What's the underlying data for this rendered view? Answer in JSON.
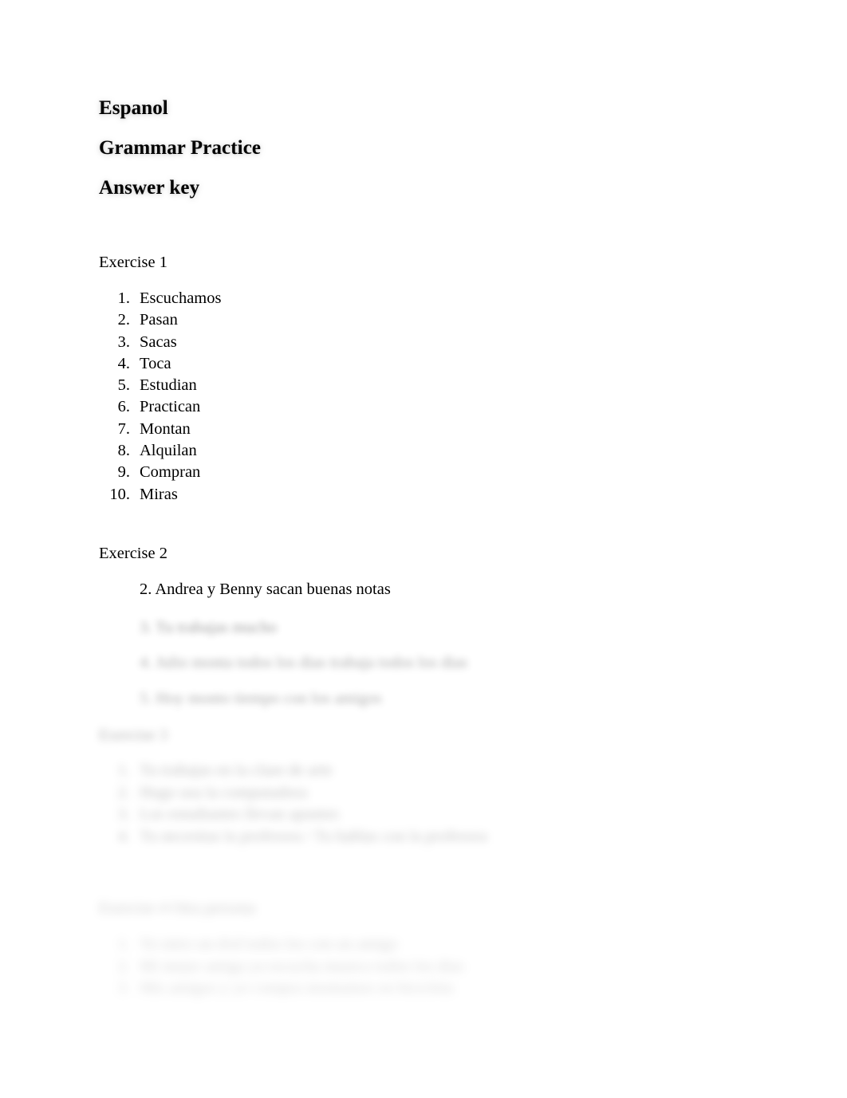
{
  "document": {
    "title_lines": [
      "Espanol",
      "Grammar Practice",
      "Answer key"
    ]
  },
  "exercise1": {
    "label": "Exercise 1",
    "items": [
      {
        "num": "1.",
        "text": "Escuchamos"
      },
      {
        "num": "2.",
        "text": "Pasan"
      },
      {
        "num": "3.",
        "text": "Sacas"
      },
      {
        "num": "4.",
        "text": "Toca"
      },
      {
        "num": "5.",
        "text": "Estudian"
      },
      {
        "num": "6.",
        "text": "Practican"
      },
      {
        "num": "7.",
        "text": "Montan"
      },
      {
        "num": "8.",
        "text": "Alquilan"
      },
      {
        "num": "9.",
        "text": "Compran"
      },
      {
        "num": "10.",
        "text": "Miras"
      }
    ]
  },
  "exercise2": {
    "label": "Exercise 2",
    "visible_item": "2. Andrea y Benny sacan buenas notas",
    "obscured_lines": [
      "3. Tu trabajas mucho",
      "4. Julio monta todos los dias trabaja todos los dias",
      "5. Hoy monto tiempo con los amigos"
    ]
  },
  "exercise3": {
    "label_obscured": "Exercise 3",
    "obscured_items": [
      {
        "num": "1.",
        "text": "Tu trabajas en la clase de arte"
      },
      {
        "num": "2.",
        "text": "Hugo usa la computadora"
      },
      {
        "num": "3.",
        "text": "Los estudiantes llevan apuntes"
      },
      {
        "num": "4.",
        "text": "Tu necesitas la profesora / Tu hablas con la profesora"
      }
    ]
  },
  "exercise4": {
    "label_obscured": "Exercise 4 Otra persona",
    "obscured_items": [
      {
        "num": "1.",
        "text": "Yo miro un dvd todos los con un amigo"
      },
      {
        "num": "2.",
        "text": "Mi mejor amiga ya escucha musica todos los dias"
      },
      {
        "num": "3.",
        "text": "Mis amigos y yo compra montamos en bicicleta"
      }
    ]
  }
}
